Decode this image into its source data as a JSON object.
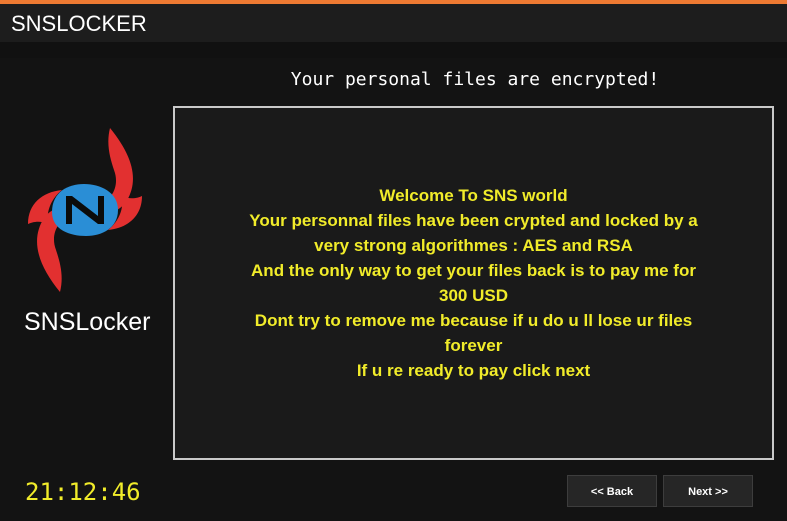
{
  "window": {
    "title": "SNSLOCKER"
  },
  "logo": {
    "name": "SNSLocker",
    "colors": {
      "flame": "#e23030",
      "emblem": "#2a8ed6"
    }
  },
  "headline": "Your personal files are encrypted!",
  "message_lines": [
    "Welcome To SNS world",
    "Your personnal files have been crypted and locked by a",
    "very strong algorithmes : AES and RSA",
    "And the only way to get your files back is to pay me for",
    "300 USD",
    "Dont try to remove me because if u do u ll lose ur files",
    "forever",
    "If u re ready to pay click next"
  ],
  "timer": "21:12:46",
  "buttons": {
    "back": "<< Back",
    "next": "Next >>"
  },
  "colors": {
    "accent_bar": "#ee7a32",
    "message_text": "#f1ec2a",
    "timer_text": "#f1ec2a"
  }
}
